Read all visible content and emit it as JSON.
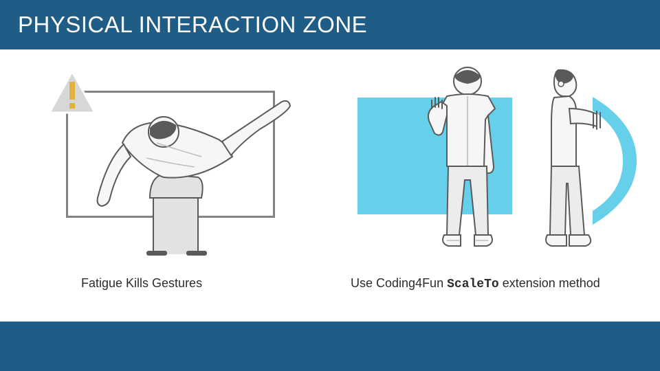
{
  "header": {
    "title": "PHYSICAL INTERACTION ZONE"
  },
  "left": {
    "caption": "Fatigue Kills Gestures"
  },
  "right": {
    "caption_pre": "Use Coding4Fun ",
    "caption_code": "ScaleTo",
    "caption_post": "  extension method"
  },
  "colors": {
    "header_bg": "#1f5c86",
    "zone": "#66d0ea",
    "warn_fill": "#d7d7d7",
    "warn_stroke": "#ffffff",
    "warn_bang": "#e1b13a",
    "person_outline": "#5a5a5a",
    "person_fill": "#f4f4f4"
  }
}
